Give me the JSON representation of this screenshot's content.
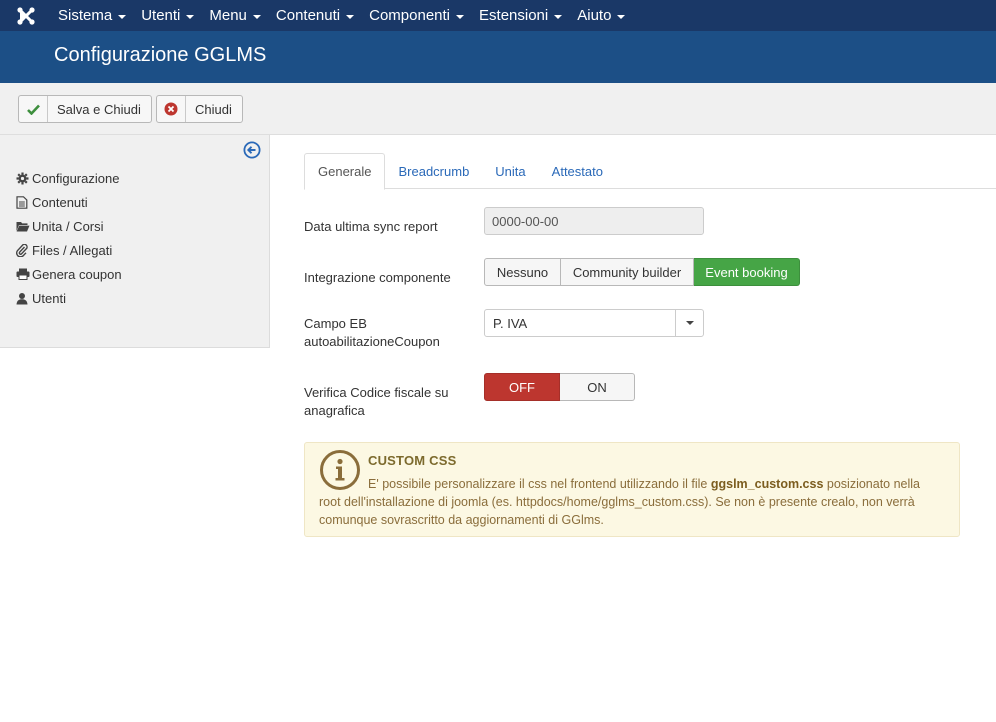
{
  "nav": {
    "items": [
      {
        "label": "Sistema"
      },
      {
        "label": "Utenti"
      },
      {
        "label": "Menu"
      },
      {
        "label": "Contenuti"
      },
      {
        "label": "Componenti"
      },
      {
        "label": "Estensioni"
      },
      {
        "label": "Aiuto"
      }
    ]
  },
  "header": {
    "title": "Configurazione GGLMS"
  },
  "toolbar": {
    "save_close_label": "Salva e Chiudi",
    "close_label": "Chiudi"
  },
  "sidebar": {
    "items": [
      {
        "label": "Configurazione",
        "icon": "gear-icon"
      },
      {
        "label": "Contenuti",
        "icon": "file-icon"
      },
      {
        "label": "Unita / Corsi",
        "icon": "folder-open-icon"
      },
      {
        "label": "Files / Allegati",
        "icon": "paperclip-icon"
      },
      {
        "label": "Genera coupon",
        "icon": "print-icon"
      },
      {
        "label": "Utenti",
        "icon": "user-icon"
      }
    ]
  },
  "tabs": [
    {
      "label": "Generale"
    },
    {
      "label": "Breadcrumb"
    },
    {
      "label": "Unita"
    },
    {
      "label": "Attestato"
    }
  ],
  "form": {
    "sync_label": "Data ultima sync report",
    "sync_value": "0000-00-00",
    "integration_label": "Integrazione componente",
    "integration_options": [
      "Nessuno",
      "Community builder",
      "Event booking"
    ],
    "integration_selected": "Event booking",
    "campo_label_1": "Campo EB",
    "campo_label_2": "autoabilitazioneCoupon",
    "campo_value": "P. IVA",
    "verifica_label_1": "Verifica Codice fiscale su",
    "verifica_label_2": "anagrafica",
    "verifica_off": "OFF",
    "verifica_on": "ON",
    "verifica_selected": "OFF"
  },
  "alert": {
    "title": "CUSTOM CSS",
    "text_part1": "E' possibile personalizzare il css nel frontend utilizzando il file",
    "filename": "ggslm_custom.css",
    "text_part2": "posizionato nella root dell'installazione di joomla (es. httpdocs/home/gglms_custom.css). Se non è presente crealo, non verrà comunque sovrascritto da aggiornamenti di GGlms."
  },
  "colors": {
    "nav_bg": "#1a3867",
    "header_bg": "#1c4f86",
    "green": "#46a546",
    "red": "#bd362f",
    "link": "#2a69b8",
    "alert_bg": "#fcf8e3"
  }
}
